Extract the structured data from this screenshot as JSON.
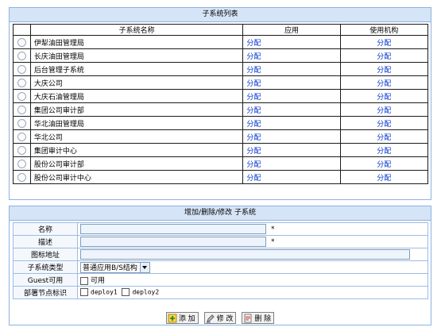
{
  "list": {
    "title": "子系统列表",
    "headers": {
      "name": "子系统名称",
      "app": "应用",
      "org": "使用机构"
    },
    "rows": [
      {
        "name": "伊犁油田管理局",
        "app": "分配",
        "org": "分配"
      },
      {
        "name": "长庆油田管理局",
        "app": "分配",
        "org": "分配"
      },
      {
        "name": "后台管理子系统",
        "app": "分配",
        "org": "分配"
      },
      {
        "name": "大庆公司",
        "app": "分配",
        "org": "分配"
      },
      {
        "name": "大庆石油管理局",
        "app": "分配",
        "org": "分配"
      },
      {
        "name": "集团公司审计部",
        "app": "分配",
        "org": "分配"
      },
      {
        "name": "华北油田管理局",
        "app": "分配",
        "org": "分配"
      },
      {
        "name": "华北公司",
        "app": "分配",
        "org": "分配"
      },
      {
        "name": "集团审计中心",
        "app": "分配",
        "org": "分配"
      },
      {
        "name": "股份公司审计部",
        "app": "分配",
        "org": "分配"
      },
      {
        "name": "股份公司审计中心",
        "app": "分配",
        "org": "分配"
      }
    ]
  },
  "form": {
    "title": "增加/删除/修改 子系统",
    "name_label": "名称",
    "name_value": "",
    "desc_label": "描述",
    "desc_value": "",
    "required_mark": "*",
    "icon_label": "图标地址",
    "icon_value": "",
    "type_label": "子系统类型",
    "type_selected": "普通应用B/S结构",
    "guest_label": "Guest可用",
    "guest_option": "可用",
    "guest_checked": false,
    "deploy_label": "部署节点标识",
    "deploy_options": [
      "deploy1",
      "deploy2"
    ]
  },
  "buttons": {
    "add": "添 加",
    "edit": "修 改",
    "delete": "删 除"
  },
  "colors": {
    "panel_border": "#8db2e3",
    "title_bg": "#d6e4f7",
    "link": "#0033cc"
  }
}
